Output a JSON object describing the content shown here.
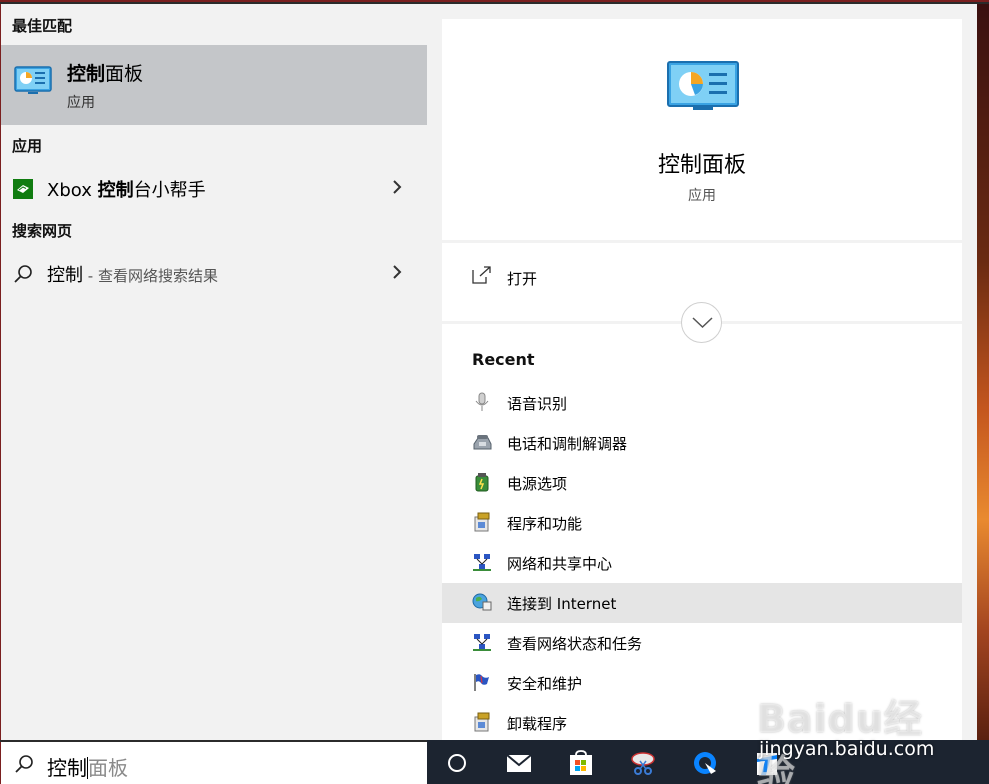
{
  "left": {
    "best_match_title": "最佳匹配",
    "best_match": {
      "name_bold": "控制",
      "name_rest": "面板",
      "type": "应用"
    },
    "apps_title": "应用",
    "apps": [
      {
        "pre": "Xbox ",
        "bold": "控制",
        "rest": "台小帮手"
      }
    ],
    "web_title": "搜索网页",
    "web": {
      "query": "控制",
      "suffix": " - 查看网络搜索结果"
    }
  },
  "search": {
    "typed": "控制",
    "ghost": "面板"
  },
  "detail": {
    "title": "控制面板",
    "type": "应用",
    "open_label": "打开",
    "recent_title": "Recent",
    "recent": [
      {
        "label": "语音识别",
        "icon": "microphone-icon"
      },
      {
        "label": "电话和调制解调器",
        "icon": "telephone-icon"
      },
      {
        "label": "电源选项",
        "icon": "power-options-icon"
      },
      {
        "label": "程序和功能",
        "icon": "programs-icon"
      },
      {
        "label": "网络和共享中心",
        "icon": "network-icon"
      },
      {
        "label": "连接到 Internet",
        "icon": "internet-globe-icon"
      },
      {
        "label": "查看网络状态和任务",
        "icon": "network-icon"
      },
      {
        "label": "安全和维护",
        "icon": "security-flag-icon"
      },
      {
        "label": "卸载程序",
        "icon": "programs-icon"
      }
    ]
  },
  "watermark": {
    "logo": "Baidu经验",
    "url": "jingyan.baidu.com"
  },
  "colors": {
    "selected": "#c4c6c9",
    "panel": "#f2f2f2",
    "taskbar": "#1c2430",
    "hover": "#e5e5e5"
  }
}
